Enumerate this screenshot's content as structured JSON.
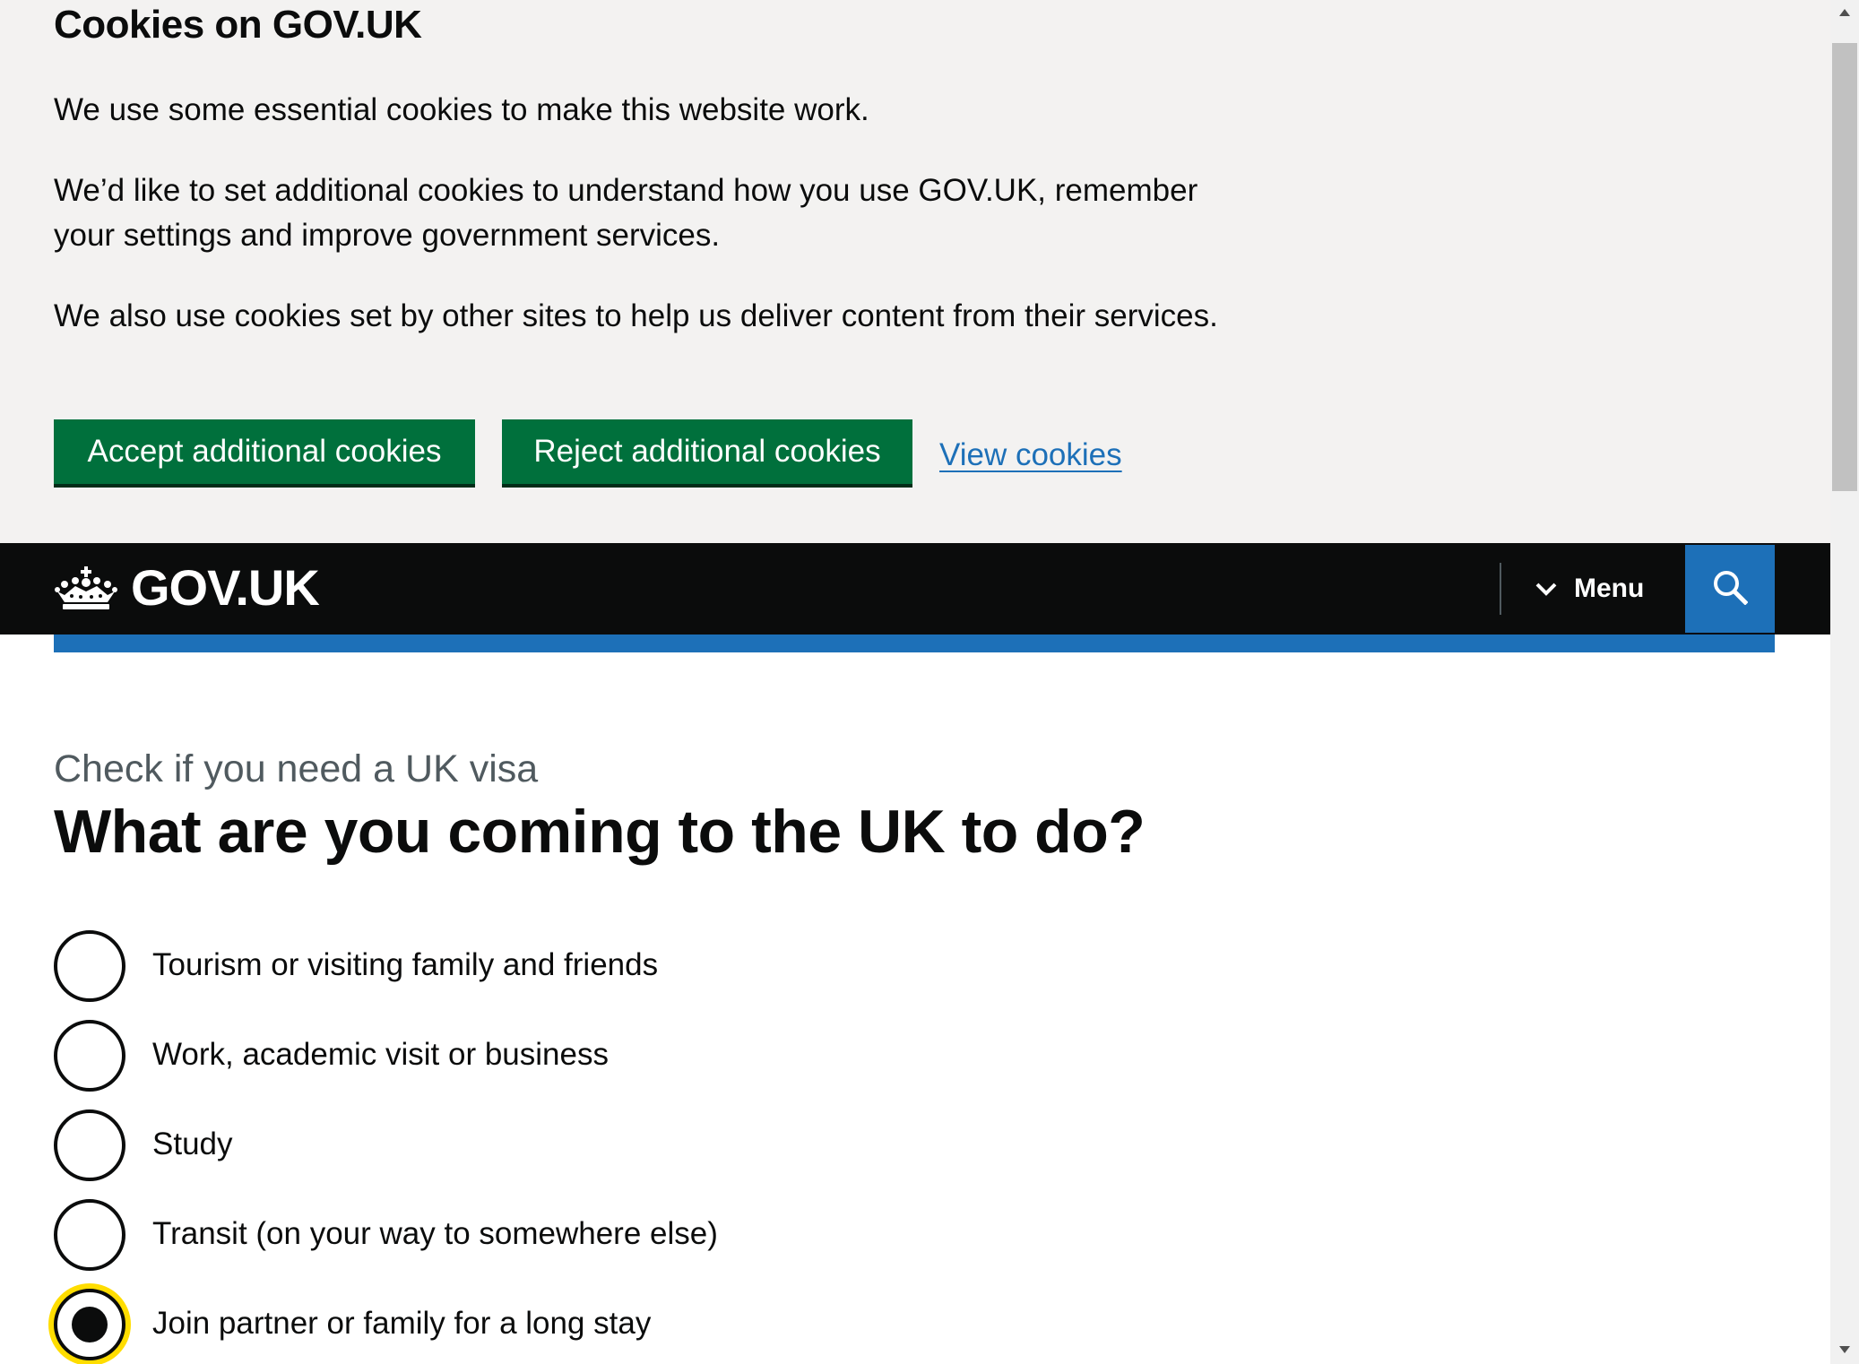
{
  "cookie_banner": {
    "title": "Cookies on GOV.UK",
    "paragraph_1": "We use some essential cookies to make this website work.",
    "paragraph_2": "We’d like to set additional cookies to understand how you use GOV.UK, remember your settings and improve government services.",
    "paragraph_3": "We also use cookies set by other sites to help us deliver content from their services.",
    "accept_label": "Accept additional cookies",
    "reject_label": "Reject additional cookies",
    "view_label": "View cookies"
  },
  "header": {
    "logo_text": "GOV.UK",
    "logo_icon": "crown-icon",
    "menu_label": "Menu",
    "menu_icon": "chevron-down-icon",
    "search_icon": "search-icon"
  },
  "main": {
    "caption": "Check if you need a UK visa",
    "heading": "What are you coming to the UK to do?",
    "options": [
      {
        "label": "Tourism or visiting family and friends",
        "selected": false
      },
      {
        "label": "Work, academic visit or business",
        "selected": false
      },
      {
        "label": "Study",
        "selected": false
      },
      {
        "label": "Transit (on your way to somewhere else)",
        "selected": false
      },
      {
        "label": "Join partner or family for a long stay",
        "selected": true
      }
    ]
  },
  "colors": {
    "button_green": "#00703c",
    "header_black": "#0b0c0c",
    "brand_blue": "#1d70b8",
    "focus_yellow": "#ffdd00",
    "banner_grey": "#f3f2f1"
  }
}
